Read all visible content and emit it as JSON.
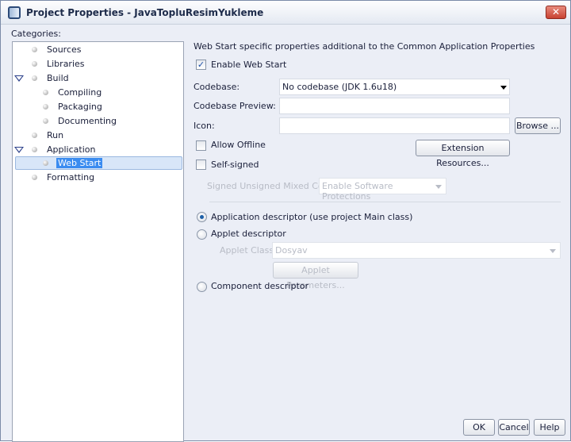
{
  "window": {
    "title": "Project Properties - JavaTopluResimYukleme",
    "close": "✕"
  },
  "categories": {
    "label": "Categories:",
    "items": [
      {
        "label": "Sources"
      },
      {
        "label": "Libraries"
      },
      {
        "label": "Build"
      },
      {
        "label": "Compiling"
      },
      {
        "label": "Packaging"
      },
      {
        "label": "Documenting"
      },
      {
        "label": "Run"
      },
      {
        "label": "Application"
      },
      {
        "label": "Web Start"
      },
      {
        "label": "Formatting"
      }
    ]
  },
  "panel": {
    "description": "Web Start specific properties additional to the Common Application Properties",
    "enable_web_start": {
      "label": "Enable Web Start",
      "checked": true
    },
    "codebase": {
      "label": "Codebase:",
      "value": "No codebase (JDK 1.6u18)"
    },
    "codebase_preview": {
      "label": "Codebase Preview:",
      "value": ""
    },
    "icon": {
      "label": "Icon:",
      "value": "",
      "browse": "Browse ..."
    },
    "allow_offline": {
      "label": "Allow Offline",
      "checked": false
    },
    "extension_resources": "Extension Resources...",
    "self_signed": {
      "label": "Self-signed",
      "checked": false
    },
    "mixed_code": {
      "label": "Signed Unsigned Mixed Code:",
      "value": "Enable Software Protections"
    },
    "app_descriptor": {
      "label": "Application descriptor (use project Main class)",
      "selected": true
    },
    "applet_descriptor": {
      "label": "Applet descriptor",
      "selected": false
    },
    "applet_class": {
      "label": "Applet Class:",
      "value": "Dosyav"
    },
    "applet_parameters": "Applet Parameters...",
    "component_descriptor": {
      "label": "Component descriptor",
      "selected": false
    }
  },
  "footer": {
    "ok": "OK",
    "cancel": "Cancel",
    "help": "Help"
  }
}
